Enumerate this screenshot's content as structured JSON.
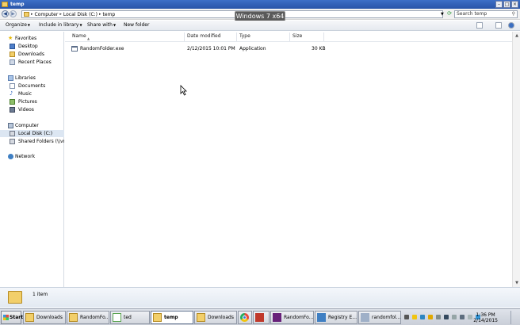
{
  "window": {
    "title": "temp"
  },
  "watermark": "Windows 7 x64",
  "address": {
    "crumbs": [
      "Computer",
      "Local Disk (C:)",
      "temp"
    ],
    "search_placeholder": "Search temp"
  },
  "toolbar": {
    "organize": "Organize",
    "include_in_library": "Include in library",
    "share_with": "Share with",
    "new_folder": "New folder"
  },
  "nav": {
    "favorites": "Favorites",
    "desktop": "Desktop",
    "downloads": "Downloads",
    "recent_places": "Recent Places",
    "libraries": "Libraries",
    "documents": "Documents",
    "music": "Music",
    "pictures": "Pictures",
    "videos": "Videos",
    "computer": "Computer",
    "local_disk": "Local Disk (C:)",
    "shared_folders": "Shared Folders (\\\\vmw",
    "network": "Network"
  },
  "columns": {
    "name": "Name",
    "date_modified": "Date modified",
    "type": "Type",
    "size": "Size"
  },
  "files": [
    {
      "name": "RandomFolder.exe",
      "date": "2/12/2015 10:01 PM",
      "type": "Application",
      "size": "30 KB"
    }
  ],
  "details": {
    "count": "1 item"
  },
  "taskbar": {
    "start": "Start",
    "tasks": [
      "Downloads",
      "RandomFo...",
      "ted",
      "temp",
      "Downloads",
      "RandomFo...",
      "Registry E...",
      "randomfol..."
    ],
    "time": "1:36 PM",
    "date": "2/14/2015"
  },
  "colors": {
    "selection": "#dce6f2",
    "titlebar": "#2854a8",
    "folder": "#f2cf6a"
  }
}
